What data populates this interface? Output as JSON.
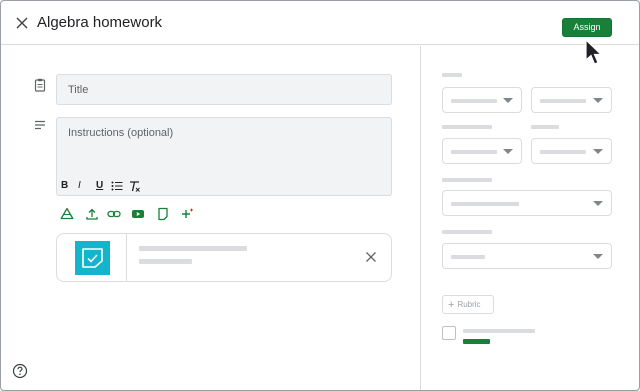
{
  "header": {
    "title": "Algebra homework",
    "close_icon": "close-icon",
    "assign_label": "Assign",
    "assign_color": "#188038"
  },
  "form": {
    "title_placeholder": "Title",
    "instructions_placeholder": "Instructions (optional)",
    "formatting": {
      "bold": "B",
      "italic": "I",
      "underline": "U",
      "list_icon": "bulleted-list-icon",
      "clear_icon": "clear-formatting-icon"
    },
    "attach_icons": [
      "drive-icon",
      "upload-icon",
      "link-icon",
      "youtube-icon",
      "create-doc-icon",
      "ai-sparkle-plus-icon"
    ],
    "attachment": {
      "thumb_color": "#12b5cb",
      "thumb_icon": "assignment-check-icon",
      "remove_icon": "close-icon"
    }
  },
  "sidebar": {
    "rubric_label": "Rubric",
    "rubric_icon": "plus-icon",
    "accent_bar_color": "#188038"
  },
  "footer": {
    "help_icon": "help-icon"
  }
}
